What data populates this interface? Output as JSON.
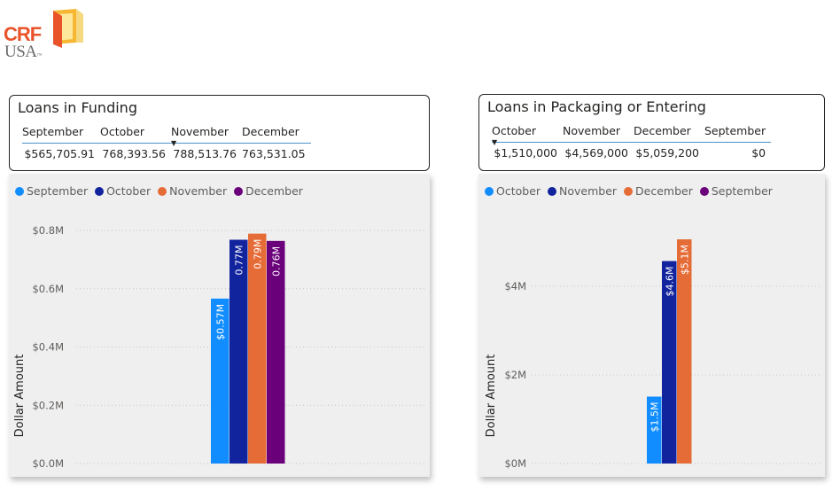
{
  "logo": {
    "text_top": "CRF",
    "text_bottom": "USA",
    "tm": "™"
  },
  "funding_table": {
    "title": "Loans in Funding",
    "headers": [
      "September",
      "October",
      "November",
      "December"
    ],
    "sorted_column": "November",
    "values": [
      "$565,705.91",
      "768,393.56",
      "788,513.76",
      "763,531.05"
    ]
  },
  "packaging_table": {
    "title": "Loans in Packaging or Entering",
    "headers": [
      "October",
      "November",
      "December",
      "September"
    ],
    "sorted_column": "October",
    "values": [
      "$1,510,000",
      "$4,569,000",
      "$5,059,200",
      "$0"
    ]
  },
  "chart_data": [
    {
      "type": "bar",
      "ylabel": "Dollar Amount",
      "ylim": [
        0,
        0.8
      ],
      "yticks": [
        0,
        0.2,
        0.4,
        0.6,
        0.8
      ],
      "ytick_labels": [
        "$0.0M",
        "$0.2M",
        "$0.4M",
        "$0.6M",
        "$0.8M"
      ],
      "grid": true,
      "legend_position": "top-left",
      "series": [
        {
          "name": "September",
          "value": 0.566,
          "label": "$0.57M",
          "color": "#118dff"
        },
        {
          "name": "October",
          "value": 0.768,
          "label": "0.77M",
          "color": "#12239e"
        },
        {
          "name": "November",
          "value": 0.789,
          "label": "0.79M",
          "color": "#e66c37"
        },
        {
          "name": "December",
          "value": 0.764,
          "label": "0.76M",
          "color": "#6b007b"
        }
      ]
    },
    {
      "type": "bar",
      "ylabel": "Dollar Amount",
      "ylim": [
        0,
        5.1
      ],
      "yticks": [
        0,
        2,
        4
      ],
      "ytick_labels": [
        "$0M",
        "$2M",
        "$4M"
      ],
      "grid": true,
      "legend_position": "top-left",
      "series": [
        {
          "name": "October",
          "value": 1.51,
          "label": "$1.5M",
          "color": "#118dff"
        },
        {
          "name": "November",
          "value": 4.569,
          "label": "$4.6M",
          "color": "#12239e"
        },
        {
          "name": "December",
          "value": 5.059,
          "label": "$5.1M",
          "color": "#e66c37"
        },
        {
          "name": "September",
          "value": 0,
          "label": "",
          "color": "#6b007b"
        }
      ]
    }
  ]
}
